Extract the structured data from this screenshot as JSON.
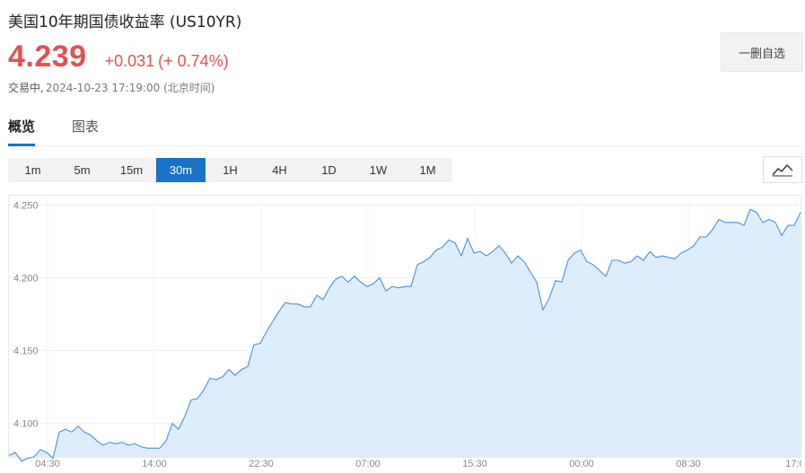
{
  "header": {
    "title": "美国10年期国债收益率 (US10YR)",
    "price": "4.239",
    "change": "+0.031",
    "change_pct": "(+ 0.74%)",
    "status": "交易中,",
    "timestamp": "2024-10-23 17:19:00 (北京时间)",
    "watch_button": "一删自选"
  },
  "tabs": [
    {
      "label": "概览",
      "active": true
    },
    {
      "label": "图表",
      "active": false
    }
  ],
  "periods": [
    {
      "label": "1m",
      "active": false
    },
    {
      "label": "5m",
      "active": false
    },
    {
      "label": "15m",
      "active": false
    },
    {
      "label": "30m",
      "active": true
    },
    {
      "label": "1H",
      "active": false
    },
    {
      "label": "4H",
      "active": false
    },
    {
      "label": "1D",
      "active": false
    },
    {
      "label": "1W",
      "active": false
    },
    {
      "label": "1M",
      "active": false
    }
  ],
  "chart_type_icon": "line-chart-icon",
  "colors": {
    "up": "#e05252",
    "accent": "#1a73c8",
    "line": "#4a90d9",
    "fill": "#deedfb"
  },
  "chart_data": {
    "type": "area",
    "x_ticks": [
      "04:30",
      "14:00",
      "22:30",
      "07:00",
      "15:30",
      "00:00",
      "08:30",
      "17:0"
    ],
    "y_ticks": [
      4.1,
      4.15,
      4.2,
      4.25
    ],
    "y_tick_labels": [
      "4.100",
      "4.150",
      "4.200",
      "4.250"
    ],
    "ylim": [
      4.077,
      4.257
    ],
    "grid": true,
    "values": [
      4.078,
      4.08,
      4.074,
      4.076,
      4.077,
      4.082,
      4.08,
      4.076,
      4.094,
      4.096,
      4.094,
      4.098,
      4.094,
      4.092,
      4.088,
      4.085,
      4.087,
      4.086,
      4.087,
      4.085,
      4.086,
      4.084,
      4.083,
      4.083,
      4.083,
      4.088,
      4.1,
      4.096,
      4.105,
      4.116,
      4.117,
      4.123,
      4.131,
      4.13,
      4.132,
      4.137,
      4.133,
      4.137,
      4.139,
      4.154,
      4.155,
      4.163,
      4.17,
      4.177,
      4.183,
      4.182,
      4.182,
      4.18,
      4.18,
      4.188,
      4.185,
      4.193,
      4.199,
      4.201,
      4.197,
      4.201,
      4.197,
      4.194,
      4.196,
      4.2,
      4.191,
      4.194,
      4.193,
      4.194,
      4.194,
      4.209,
      4.211,
      4.214,
      4.219,
      4.221,
      4.226,
      4.224,
      4.215,
      4.227,
      4.217,
      4.218,
      4.215,
      4.218,
      4.222,
      4.217,
      4.21,
      4.215,
      4.211,
      4.204,
      4.197,
      4.178,
      4.186,
      4.198,
      4.197,
      4.212,
      4.217,
      4.219,
      4.211,
      4.209,
      4.205,
      4.201,
      4.212,
      4.212,
      4.21,
      4.211,
      4.215,
      4.212,
      4.218,
      4.214,
      4.215,
      4.214,
      4.213,
      4.217,
      4.219,
      4.222,
      4.228,
      4.228,
      4.233,
      4.24,
      4.238,
      4.238,
      4.238,
      4.236,
      4.247,
      4.245,
      4.238,
      4.24,
      4.238,
      4.229,
      4.236,
      4.236,
      4.245
    ]
  }
}
